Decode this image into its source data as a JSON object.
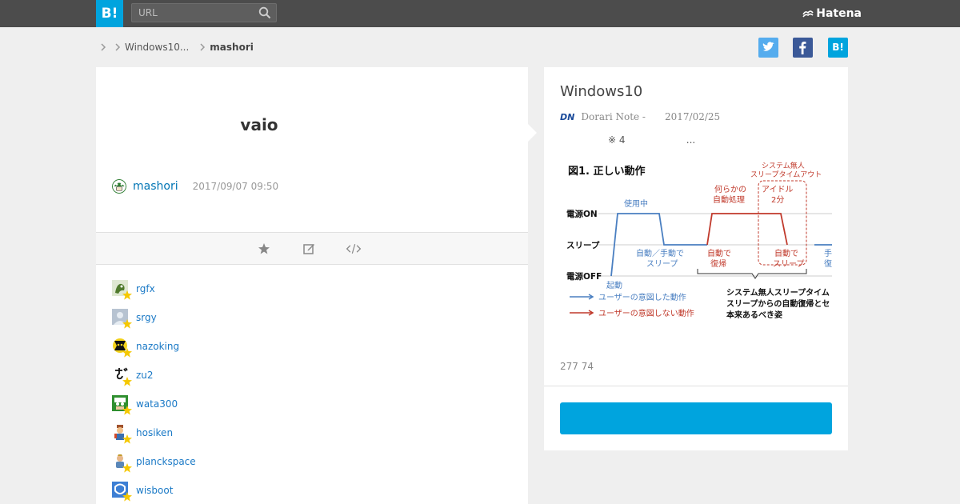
{
  "header": {
    "logo_text": "B!",
    "search_placeholder": "URL",
    "brand": "Hatena"
  },
  "breadcrumb": {
    "items": [
      "Windows10...",
      "mashori"
    ]
  },
  "share": {
    "hatena_label": "B!"
  },
  "entry": {
    "title": "vaio",
    "author": "mashori",
    "timestamp": "2017/09/07 09:50"
  },
  "stars": [
    {
      "name": "rgfx"
    },
    {
      "name": "srgy"
    },
    {
      "name": "nazoking"
    },
    {
      "name": "zu2"
    },
    {
      "name": "wata300"
    },
    {
      "name": "hosiken"
    },
    {
      "name": "planckspace"
    },
    {
      "name": "wisboot"
    }
  ],
  "article": {
    "title": "Windows10",
    "site_badge": "DN",
    "site": "Dorari Note -",
    "date": "2017/02/25",
    "excerpt": "※ 4                    ...",
    "count": "277 74",
    "figure": {
      "title": "図1. 正しい動作",
      "top_note": "システム無人\nスリープタイムアウト",
      "labels": {
        "in_use": "使用中",
        "some_auto": "何らかの\n自動処理",
        "idle": "アイドル\n2分",
        "power_on": "電源ON",
        "sleep": "スリープ",
        "power_off": "電源OFF",
        "boot": "起動",
        "auto_manual": "自動／手動で\nスリープ",
        "auto_resume": "自動で\n復帰",
        "auto_sleep": "自動で\nスリープ",
        "intended": "ユーザーの意図した動作",
        "unintended": "ユーザーの意図しない動作",
        "bottom_note": "システム無人スリープタイム\nスリープからの自動復帰とセ\n本来あるべき姿"
      }
    }
  },
  "colors": {
    "accent": "#00a4de",
    "topbar": "#4c4c4c",
    "link": "#0075b5",
    "star": "#f5c800",
    "fig_blue": "#4a7fc1",
    "fig_red": "#c0392b"
  }
}
